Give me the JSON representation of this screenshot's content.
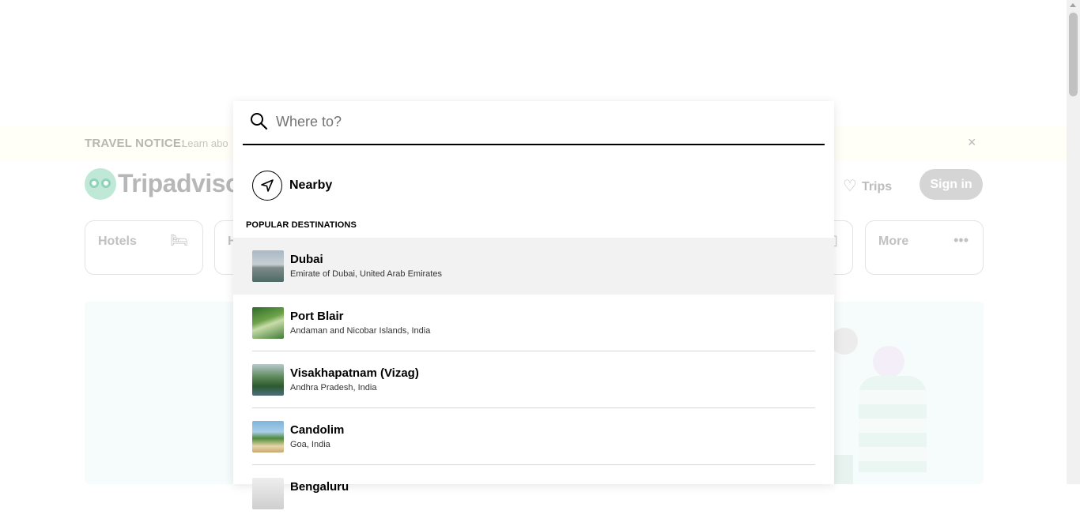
{
  "notice": {
    "label": "TRAVEL NOTICE:",
    "link_text": "Learn abo",
    "close": "×"
  },
  "header": {
    "logo_text": "Tripadvisor",
    "trips_label": "Trips",
    "signin_label": "Sign in"
  },
  "categories": [
    {
      "label": "Hotels",
      "icon": "bed-icon",
      "glyph": "🛏"
    },
    {
      "label": "H",
      "icon": "",
      "glyph": ""
    },
    {
      "label": "",
      "icon": "building-icon",
      "glyph": "▯"
    },
    {
      "label": "More",
      "icon": "more-icon",
      "glyph": "•••"
    }
  ],
  "search": {
    "placeholder": "Where to?",
    "value": ""
  },
  "nearby": {
    "label": "Nearby"
  },
  "popular": {
    "title": "POPULAR DESTINATIONS",
    "items": [
      {
        "name": "Dubai",
        "sub": "Emirate of Dubai, United Arab Emirates"
      },
      {
        "name": "Port Blair",
        "sub": "Andaman and Nicobar Islands, India"
      },
      {
        "name": "Visakhapatnam (Vizag)",
        "sub": "Andhra Pradesh, India"
      },
      {
        "name": "Candolim",
        "sub": "Goa, India"
      },
      {
        "name": "Bengaluru",
        "sub": ""
      }
    ]
  },
  "colors": {
    "accent": "#000000",
    "active_row": "#f2f2f2",
    "signin_bg": "#d5d5d5"
  }
}
